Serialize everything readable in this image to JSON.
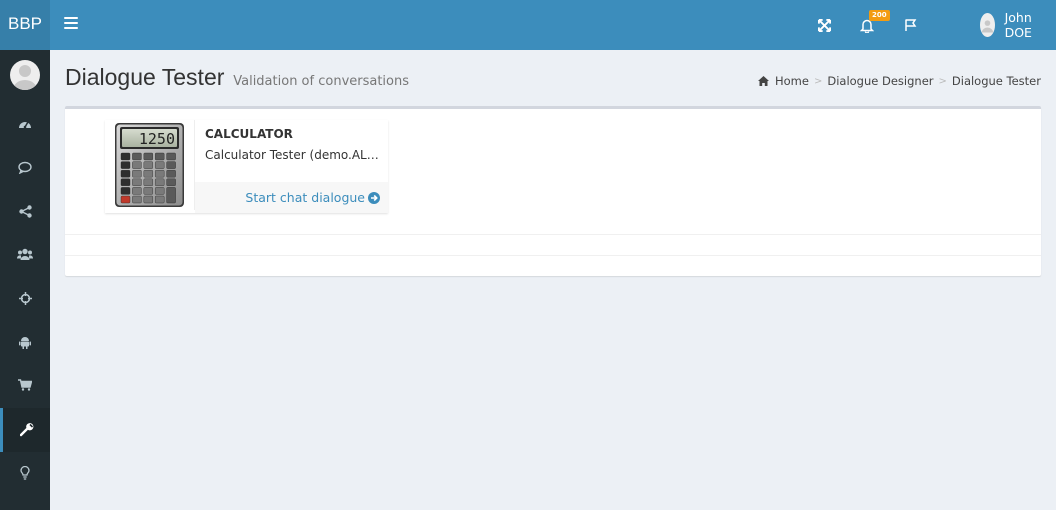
{
  "app": {
    "brand": "BBP"
  },
  "topbar": {
    "notifications_count": "200",
    "user_name": "John DOE"
  },
  "sidebar": {
    "items": [
      {
        "icon": "dashboard-icon"
      },
      {
        "icon": "chat-bubble-icon"
      },
      {
        "icon": "share-icon"
      },
      {
        "icon": "users-icon"
      },
      {
        "icon": "crosshair-icon"
      },
      {
        "icon": "android-icon"
      },
      {
        "icon": "shopping-cart-icon"
      },
      {
        "icon": "wrench-icon",
        "active": true
      },
      {
        "icon": "lightbulb-icon"
      }
    ]
  },
  "header": {
    "title": "Dialogue Tester",
    "subtitle": "Validation of conversations"
  },
  "breadcrumb": {
    "home": "Home",
    "designer": "Dialogue Designer",
    "current": "Dialogue Tester"
  },
  "card": {
    "title": "CALCULATOR",
    "description": "Calculator Tester (demo.ALICE)",
    "action_label": "Start chat dialogue",
    "display_value": "1250"
  },
  "colors": {
    "primary": "#3c8dbc",
    "brand_bg": "#367fa9",
    "sidebar_bg": "#222d32",
    "badge": "#f39c12",
    "page_bg": "#ecf0f5"
  }
}
